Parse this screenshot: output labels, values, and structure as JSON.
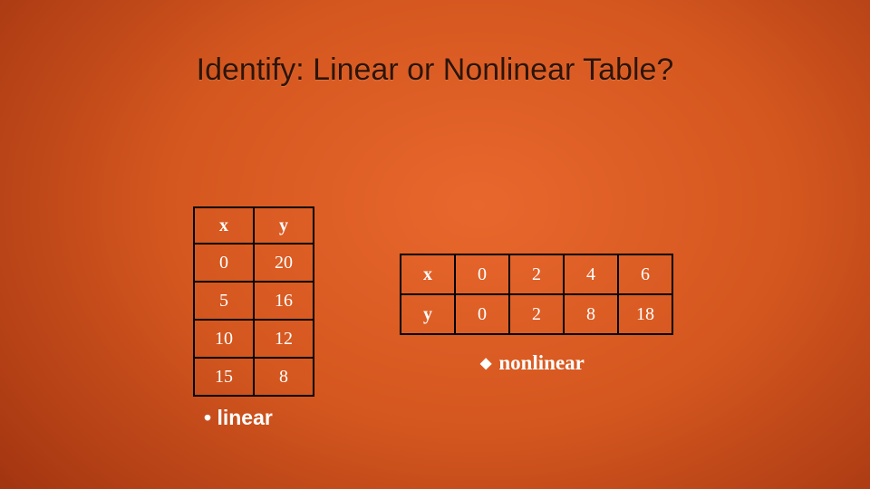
{
  "title": "Identify: Linear or Nonlinear Table?",
  "left_table": {
    "header": {
      "col0": "x",
      "col1": "y"
    },
    "rows": [
      {
        "x": "0",
        "y": "20"
      },
      {
        "x": "5",
        "y": "16"
      },
      {
        "x": "10",
        "y": "12"
      },
      {
        "x": "15",
        "y": "8"
      }
    ],
    "caption": "linear"
  },
  "right_table": {
    "row_headers": {
      "r0": "x",
      "r1": "y"
    },
    "cols": [
      {
        "x": "0",
        "y": "0"
      },
      {
        "x": "2",
        "y": "2"
      },
      {
        "x": "4",
        "y": "8"
      },
      {
        "x": "6",
        "y": "18"
      }
    ],
    "caption": "nonlinear"
  },
  "chart_data": [
    {
      "type": "table",
      "orientation": "columns",
      "columns": [
        "x",
        "y"
      ],
      "data": [
        [
          0,
          20
        ],
        [
          5,
          16
        ],
        [
          10,
          12
        ],
        [
          15,
          8
        ]
      ],
      "classification": "linear"
    },
    {
      "type": "table",
      "orientation": "rows",
      "rows_labels": [
        "x",
        "y"
      ],
      "data": {
        "x": [
          0,
          2,
          4,
          6
        ],
        "y": [
          0,
          2,
          8,
          18
        ]
      },
      "classification": "nonlinear"
    }
  ]
}
